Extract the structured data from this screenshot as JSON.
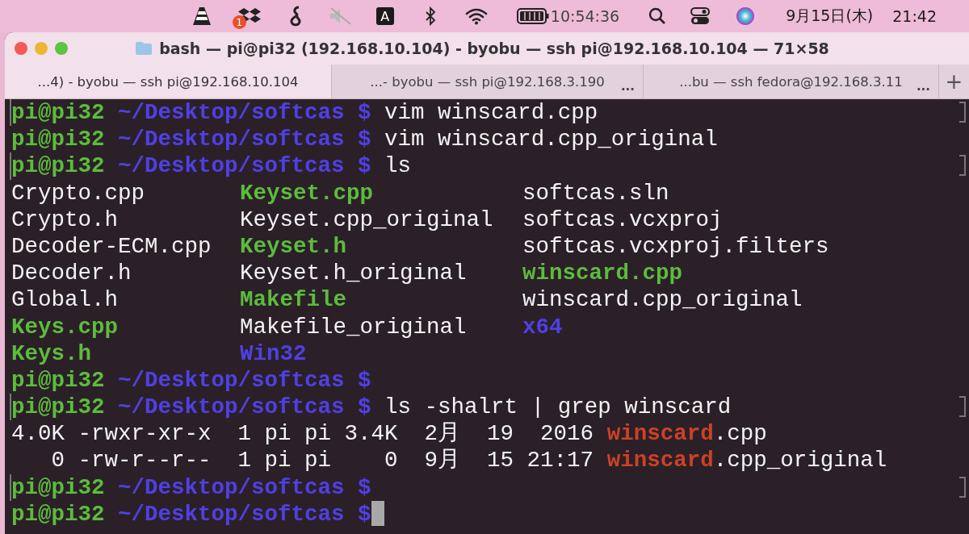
{
  "menu_bar": {
    "notification_badge": "1",
    "input_source": "A",
    "clock": "10:54:36",
    "date": "9月15日(木)",
    "time": "21:42"
  },
  "window": {
    "title": "bash — pi@pi32 (192.168.10.104) - byobu — ssh pi@192.168.10.104 — 71×58"
  },
  "tabs": [
    {
      "label": "...4) - byobu — ssh pi@192.168.10.104",
      "selected": true
    },
    {
      "label": "...- byobu — ssh pi@192.168.3.190",
      "selected": false,
      "more": "..."
    },
    {
      "label": "...bu — ssh fedora@192.168.3.11",
      "selected": false,
      "more": "..."
    }
  ],
  "new_tab": "+",
  "terminal": {
    "lines": [
      {
        "kind": "prompt",
        "marked": true,
        "user": "pi@pi32",
        "path": " ~/Desktop/softcas $",
        "command": " vim winscard.cpp"
      },
      {
        "kind": "prompt",
        "marked": false,
        "user": "pi@pi32",
        "path": " ~/Desktop/softcas $",
        "command": " vim winscard.cpp_original"
      },
      {
        "kind": "prompt",
        "marked": true,
        "user": "pi@pi32",
        "path": " ~/Desktop/softcas $",
        "command": " ls"
      },
      {
        "kind": "files",
        "cells": [
          {
            "name": "Crypto.cpp",
            "color": "#f3f3f3"
          },
          {
            "name": "Keyset.cpp",
            "color": "#5cbc3c"
          },
          {
            "name": "softcas.sln",
            "color": "#f3f3f3"
          }
        ]
      },
      {
        "kind": "files",
        "cells": [
          {
            "name": "Crypto.h",
            "color": "#f3f3f3"
          },
          {
            "name": "Keyset.cpp_original",
            "color": "#f3f3f3"
          },
          {
            "name": "softcas.vcxproj",
            "color": "#f3f3f3"
          }
        ]
      },
      {
        "kind": "files",
        "cells": [
          {
            "name": "Decoder-ECM.cpp",
            "color": "#f3f3f3"
          },
          {
            "name": "Keyset.h",
            "color": "#5cbc3c"
          },
          {
            "name": "softcas.vcxproj.filters",
            "color": "#f3f3f3"
          }
        ]
      },
      {
        "kind": "files",
        "cells": [
          {
            "name": "Decoder.h",
            "color": "#f3f3f3"
          },
          {
            "name": "Keyset.h_original",
            "color": "#f3f3f3"
          },
          {
            "name": "winscard.cpp",
            "color": "#5cbc3c"
          }
        ]
      },
      {
        "kind": "files",
        "cells": [
          {
            "name": "Global.h",
            "color": "#f3f3f3"
          },
          {
            "name": "Makefile",
            "color": "#5cbc3c"
          },
          {
            "name": "winscard.cpp_original",
            "color": "#f3f3f3"
          }
        ]
      },
      {
        "kind": "files",
        "cells": [
          {
            "name": "Keys.cpp",
            "color": "#5cbc3c"
          },
          {
            "name": "Makefile_original",
            "color": "#f3f3f3"
          },
          {
            "name": "x64",
            "color": "#4f40e4"
          }
        ]
      },
      {
        "kind": "files",
        "cells": [
          {
            "name": "Keys.h",
            "color": "#5cbc3c"
          },
          {
            "name": "Win32",
            "color": "#4f40e4"
          }
        ]
      },
      {
        "kind": "prompt",
        "marked": false,
        "user": "pi@pi32",
        "path": " ~/Desktop/softcas $"
      },
      {
        "kind": "prompt",
        "marked": true,
        "user": "pi@pi32",
        "path": " ~/Desktop/softcas $",
        "command": " ls -shalrt | grep winscard"
      },
      {
        "kind": "output",
        "before": "4.0K -rwxr-xr-x  1 pi pi 3.4K  2月  19  2016 ",
        "match": "winscard",
        "after": ".cpp"
      },
      {
        "kind": "output",
        "before": "   0 -rw-r--r--  1 pi pi    0  9月  15 21:17 ",
        "match": "winscard",
        "after": ".cpp_original"
      },
      {
        "kind": "prompt",
        "marked": true,
        "user": "pi@pi32",
        "path": " ~/Desktop/softcas $"
      },
      {
        "kind": "prompt",
        "marked": false,
        "user": "pi@pi32",
        "path": " ~/Desktop/softcas $",
        "cursor": true
      }
    ]
  }
}
